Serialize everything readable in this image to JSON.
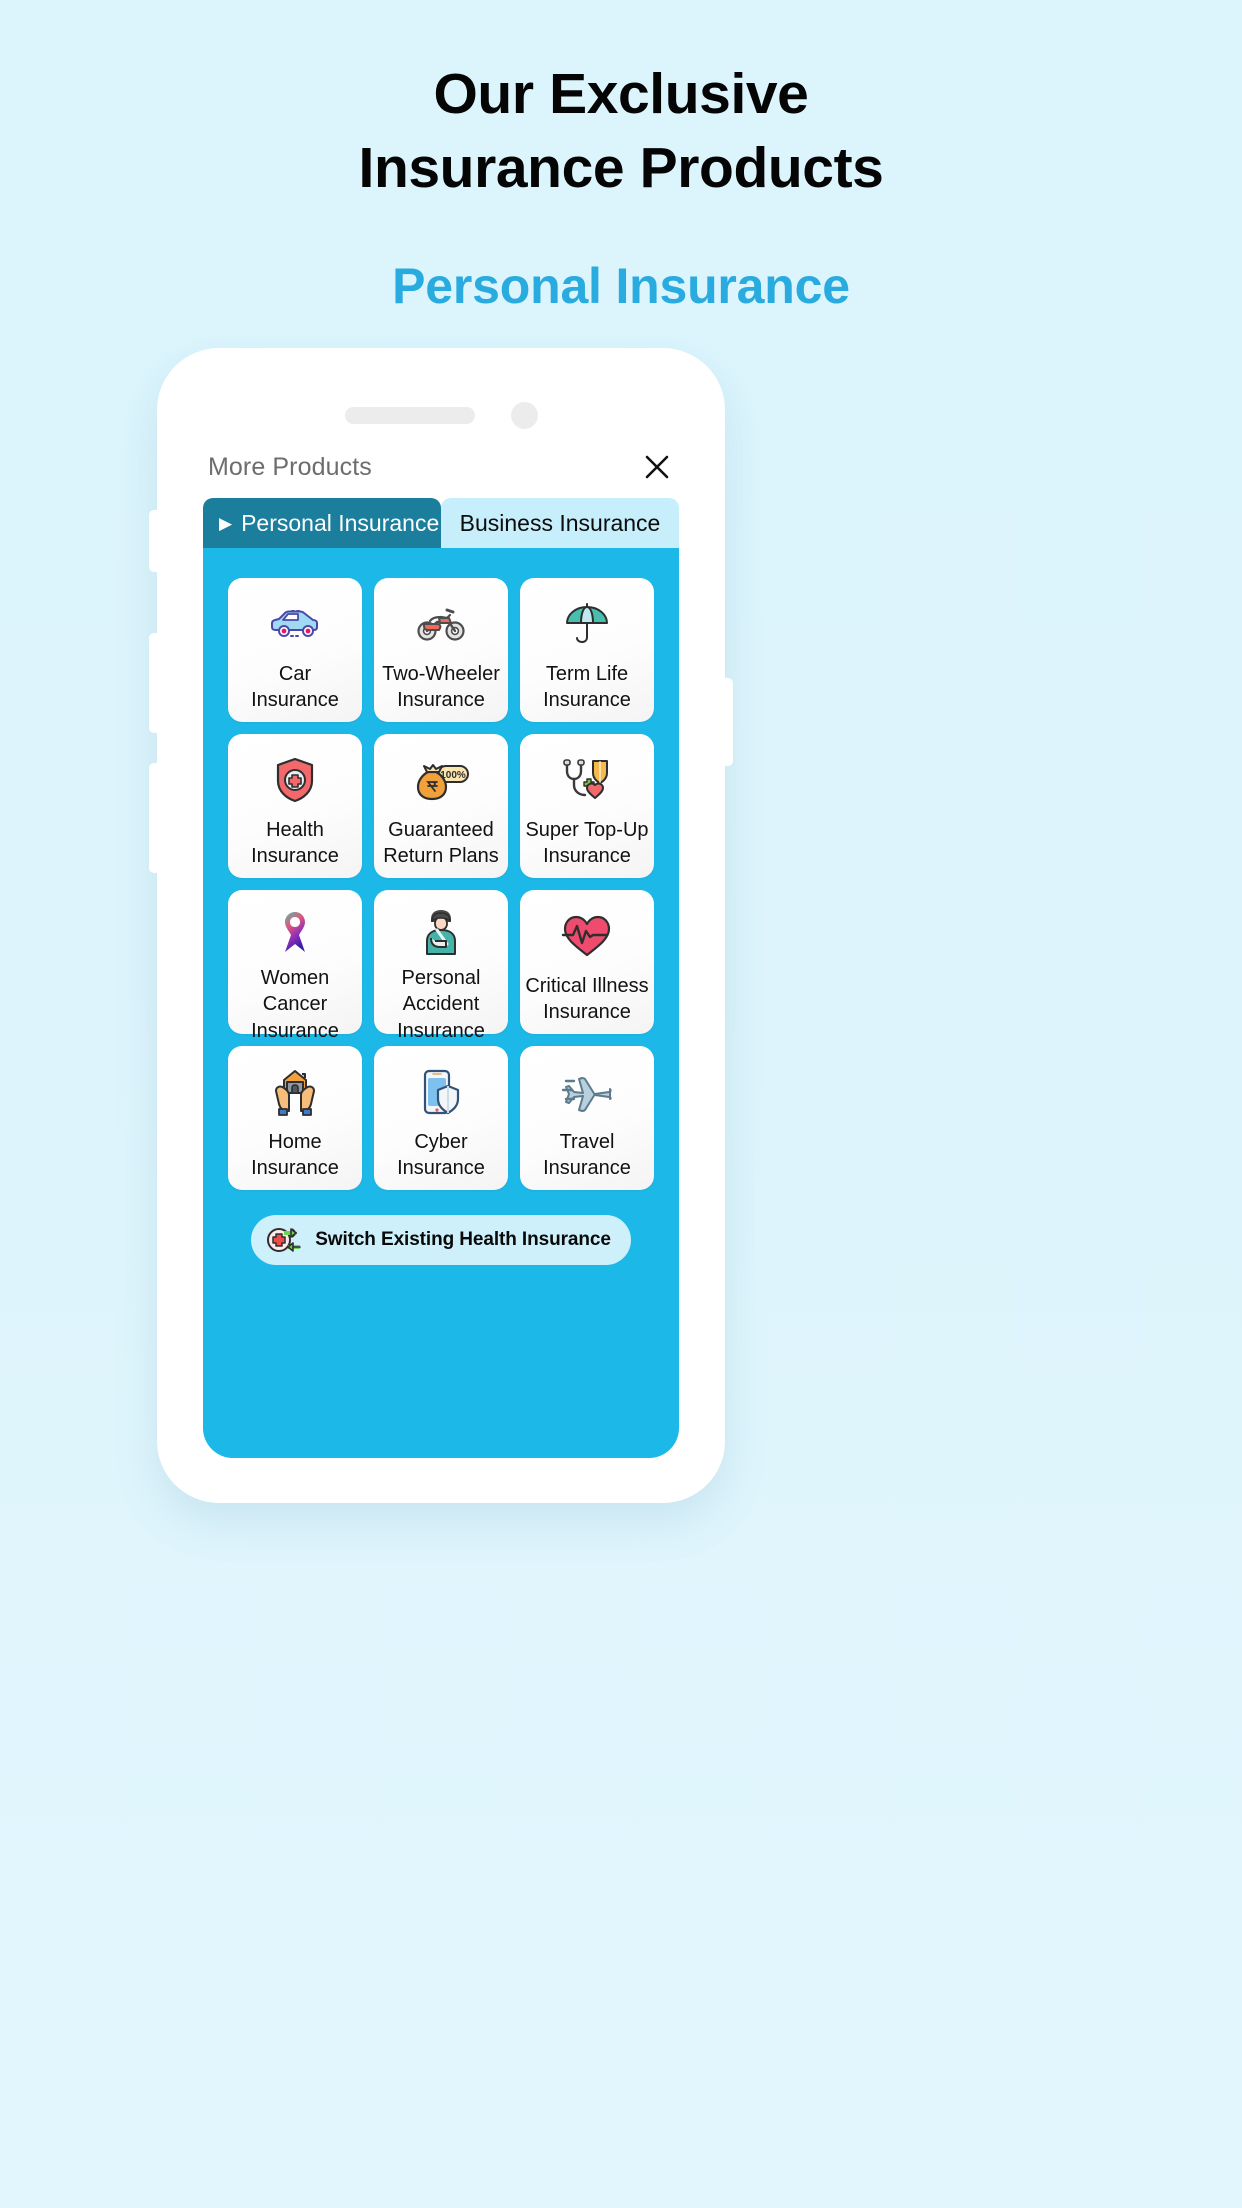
{
  "hero": {
    "headline_line1": "Our Exclusive",
    "headline_line2": "Insurance Products",
    "subheadline": "Personal Insurance",
    "accent_color": "#2aabdf"
  },
  "phone": {
    "sheet": {
      "title": "More Products",
      "close_icon": "close-icon"
    },
    "tabs": [
      {
        "label": "Personal Insurance",
        "active": true,
        "caret": "▶"
      },
      {
        "label": "Business Insurance",
        "active": false
      }
    ],
    "panel_color": "#1cb8e8",
    "products": [
      {
        "label": "Car\nInsurance",
        "icon": "car-icon"
      },
      {
        "label": "Two-Wheeler\nInsurance",
        "icon": "motorcycle-icon"
      },
      {
        "label": "Term Life\nInsurance",
        "icon": "umbrella-icon"
      },
      {
        "label": "Health\nInsurance",
        "icon": "shield-cross-icon"
      },
      {
        "label": "Guaranteed\nReturn Plans",
        "icon": "money-bag-icon"
      },
      {
        "label": "Super Top-Up\nInsurance",
        "icon": "stethoscope-heart-icon"
      },
      {
        "label": "Women Cancer\nInsurance",
        "icon": "ribbon-icon"
      },
      {
        "label": "Personal Accident\nInsurance",
        "icon": "injured-person-icon"
      },
      {
        "label": "Critical Illness\nInsurance",
        "icon": "heart-pulse-icon"
      },
      {
        "label": "Home\nInsurance",
        "icon": "hands-house-icon"
      },
      {
        "label": "Cyber\nInsurance",
        "icon": "phone-shield-icon"
      },
      {
        "label": "Travel\nInsurance",
        "icon": "airplane-icon"
      }
    ],
    "switch_button": {
      "label": "Switch Existing Health Insurance",
      "icon": "switch-health-icon"
    }
  }
}
